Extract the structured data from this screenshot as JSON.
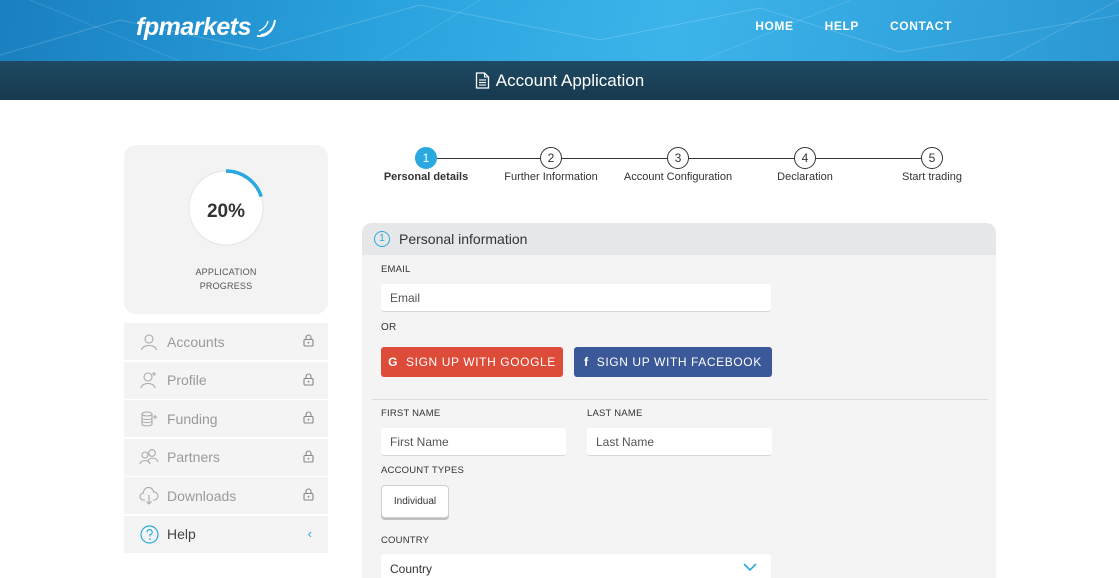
{
  "header": {
    "logo_text": "fpmarkets",
    "nav": [
      {
        "label": "HOME"
      },
      {
        "label": "HELP"
      },
      {
        "label": "CONTACT"
      }
    ],
    "subtitle": "Account Application"
  },
  "progress": {
    "percent_text": "20%",
    "percent_value": 20,
    "label_line1": "APPLICATION",
    "label_line2": "PROGRESS",
    "accent_color": "#2aa8e0"
  },
  "sidebar": {
    "items": [
      {
        "label": "Accounts",
        "icon": "user-icon",
        "locked": true
      },
      {
        "label": "Profile",
        "icon": "user-plus-icon",
        "locked": true
      },
      {
        "label": "Funding",
        "icon": "coins-icon",
        "locked": true
      },
      {
        "label": "Partners",
        "icon": "users-icon",
        "locked": true
      },
      {
        "label": "Downloads",
        "icon": "cloud-download-icon",
        "locked": true
      },
      {
        "label": "Help",
        "icon": "question-circle-icon",
        "locked": false
      }
    ]
  },
  "stepper": {
    "steps": [
      {
        "number": "1",
        "label": "Personal details",
        "active": true
      },
      {
        "number": "2",
        "label": "Further Information",
        "active": false
      },
      {
        "number": "3",
        "label": "Account Configuration",
        "active": false
      },
      {
        "number": "4",
        "label": "Declaration",
        "active": false
      },
      {
        "number": "5",
        "label": "Start trading",
        "active": false
      }
    ]
  },
  "form": {
    "section_number": "1",
    "section_title": "Personal information",
    "email_label": "EMAIL",
    "email_placeholder": "Email",
    "or_text": "OR",
    "google_label": "SIGN UP WITH GOOGLE",
    "facebook_label": "SIGN UP WITH FACEBOOK",
    "first_name_label": "FIRST NAME",
    "first_name_placeholder": "First Name",
    "last_name_label": "LAST NAME",
    "last_name_placeholder": "Last Name",
    "account_types_label": "ACCOUNT TYPES",
    "account_type_option": "Individual",
    "country_label": "COUNTRY",
    "country_value": "Country",
    "colors": {
      "google": "#dd4b39",
      "facebook": "#3b5998"
    }
  }
}
